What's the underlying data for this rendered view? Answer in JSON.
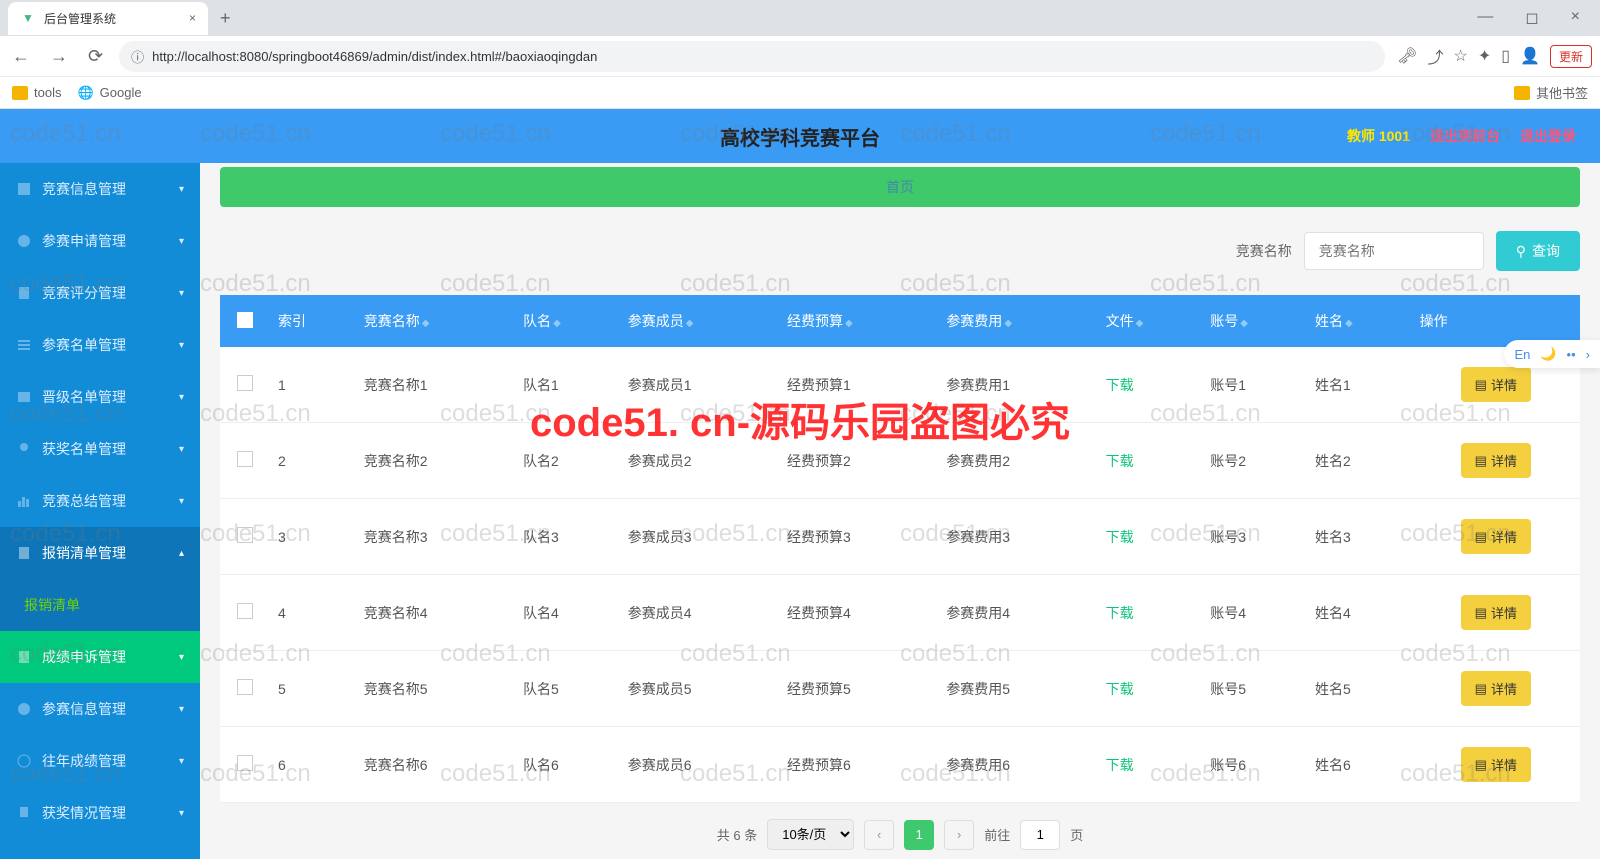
{
  "browser": {
    "tab_title": "后台管理系统",
    "url": "http://localhost:8080/springboot46869/admin/dist/index.html#/baoxiaoqingdan",
    "bookmarks": {
      "tools": "tools",
      "google": "Google",
      "other": "其他书签"
    },
    "update": "更新"
  },
  "header": {
    "title": "高校学科竞赛平台",
    "user": "教师 1001",
    "exit_front": "退出到前台",
    "logout": "退出登录"
  },
  "breadcrumb": {
    "home": "首页"
  },
  "sidebar": {
    "items": [
      {
        "label": "竞赛信息管理",
        "active": false
      },
      {
        "label": "参赛申请管理",
        "active": false
      },
      {
        "label": "竞赛评分管理",
        "active": false
      },
      {
        "label": "参赛名单管理",
        "active": false
      },
      {
        "label": "晋级名单管理",
        "active": false
      },
      {
        "label": "获奖名单管理",
        "active": false
      },
      {
        "label": "竞赛总结管理",
        "active": false
      },
      {
        "label": "报销清单管理",
        "active": true
      },
      {
        "label": "报销清单",
        "sub": true
      },
      {
        "label": "成绩申诉管理",
        "highlighted": true
      },
      {
        "label": "参赛信息管理",
        "active": false
      },
      {
        "label": "往年成绩管理",
        "active": false
      },
      {
        "label": "获奖情况管理",
        "active": false
      }
    ]
  },
  "search": {
    "label": "竞赛名称",
    "placeholder": "竞赛名称",
    "button": "查询"
  },
  "table": {
    "headers": {
      "index": "索引",
      "name": "竞赛名称",
      "team": "队名",
      "members": "参赛成员",
      "budget": "经费预算",
      "fee": "参赛费用",
      "file": "文件",
      "account": "账号",
      "person": "姓名",
      "action": "操作"
    },
    "rows": [
      {
        "idx": "1",
        "name": "竞赛名称1",
        "team": "队名1",
        "members": "参赛成员1",
        "budget": "经费预算1",
        "fee": "参赛费用1",
        "file": "下载",
        "account": "账号1",
        "person": "姓名1"
      },
      {
        "idx": "2",
        "name": "竞赛名称2",
        "team": "队名2",
        "members": "参赛成员2",
        "budget": "经费预算2",
        "fee": "参赛费用2",
        "file": "下载",
        "account": "账号2",
        "person": "姓名2"
      },
      {
        "idx": "3",
        "name": "竞赛名称3",
        "team": "队名3",
        "members": "参赛成员3",
        "budget": "经费预算3",
        "fee": "参赛费用3",
        "file": "下载",
        "account": "账号3",
        "person": "姓名3"
      },
      {
        "idx": "4",
        "name": "竞赛名称4",
        "team": "队名4",
        "members": "参赛成员4",
        "budget": "经费预算4",
        "fee": "参赛费用4",
        "file": "下载",
        "account": "账号4",
        "person": "姓名4"
      },
      {
        "idx": "5",
        "name": "竞赛名称5",
        "team": "队名5",
        "members": "参赛成员5",
        "budget": "经费预算5",
        "fee": "参赛费用5",
        "file": "下载",
        "account": "账号5",
        "person": "姓名5"
      },
      {
        "idx": "6",
        "name": "竞赛名称6",
        "team": "队名6",
        "members": "参赛成员6",
        "budget": "经费预算6",
        "fee": "参赛费用6",
        "file": "下载",
        "account": "账号6",
        "person": "姓名6"
      }
    ],
    "detail_btn": "详情"
  },
  "pagination": {
    "total": "共 6 条",
    "per_page": "10条/页",
    "current": "1",
    "goto": "前往",
    "page_suffix": "页",
    "goto_value": "1"
  },
  "widget": {
    "en": "En",
    "moon": "🌙",
    "dots": "••",
    "arrow": "›"
  },
  "watermark": {
    "text": "code51.cn",
    "center": "code51. cn-源码乐园盗图必究"
  }
}
